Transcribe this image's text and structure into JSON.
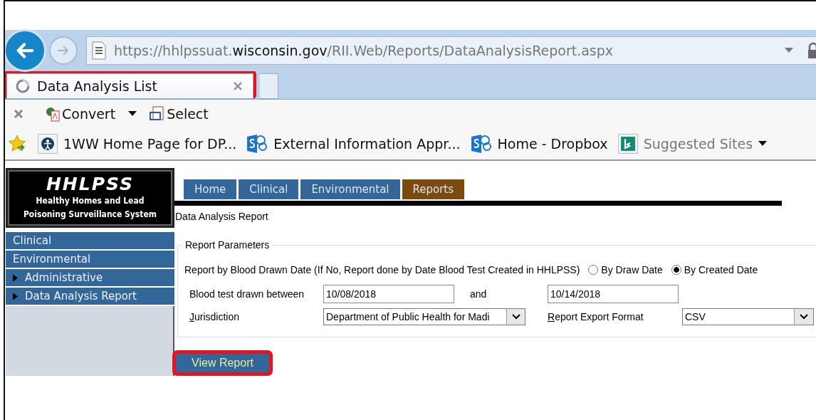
{
  "browser": {
    "url_parts": [
      {
        "text": "https://hhlpssuat.",
        "emphasis": false
      },
      {
        "text": "wisconsin.gov",
        "emphasis": true
      },
      {
        "text": "/RII.Web/Reports/DataAnalysisReport.aspx",
        "emphasis": false
      }
    ],
    "tabs": [
      {
        "title": "Data Analysis List",
        "selected": true,
        "loading": true,
        "highlighted": true
      }
    ],
    "command_bar": [
      {
        "label": "Convert",
        "kind": "convert",
        "dropdown": true
      },
      {
        "label": "Select",
        "kind": "select",
        "dropdown": false
      }
    ],
    "favorites": [
      {
        "label": "1WW Home Page for DP...",
        "kind": "globe",
        "muted": false,
        "dropdown": false
      },
      {
        "label": "External Information Appr...",
        "kind": "sharepoint",
        "muted": false,
        "dropdown": false
      },
      {
        "label": "Home - Dropbox",
        "kind": "sharepoint",
        "muted": false,
        "dropdown": false
      },
      {
        "label": "Suggested Sites",
        "kind": "bing",
        "muted": true,
        "dropdown": true
      }
    ]
  },
  "logo": {
    "title": "HHLPSS",
    "subtitle_lines": [
      "Healthy Homes and Lead",
      "Poisoning Surveillance System"
    ]
  },
  "nav_tabs": [
    {
      "label": "Home",
      "selected": false
    },
    {
      "label": "Clinical",
      "selected": false
    },
    {
      "label": "Environmental",
      "selected": false
    },
    {
      "label": "Reports",
      "selected": true
    }
  ],
  "sidebar": {
    "items": [
      {
        "label": "Clinical",
        "kind": "plain"
      },
      {
        "label": "Environmental",
        "kind": "plain"
      },
      {
        "label": "Administrative",
        "kind": "expandable"
      },
      {
        "label": "Data Analysis Report",
        "kind": "expandable"
      }
    ]
  },
  "page_title": "Data Analysis Report",
  "parameters": {
    "legend": "Report Parameters",
    "report_by": {
      "label": "Report by Blood Drawn Date (If No, Report done by Date Blood Test Created in HHLPSS)",
      "options": [
        {
          "label": "By Draw Date",
          "selected": false
        },
        {
          "label": "By Created Date",
          "selected": true
        }
      ]
    },
    "date_range": {
      "label": "Blood test drawn between",
      "from": "10/08/2018",
      "joiner": "and",
      "to": "10/14/2018"
    },
    "jurisdiction": {
      "label": "Jurisdiction",
      "access_key": true,
      "value": "Department of Public Health for Madi"
    },
    "export_format": {
      "label": "Report Export Format",
      "access_key": true,
      "value": "CSV"
    }
  },
  "view_report_button": {
    "label": "View Report",
    "highlighted": true
  }
}
